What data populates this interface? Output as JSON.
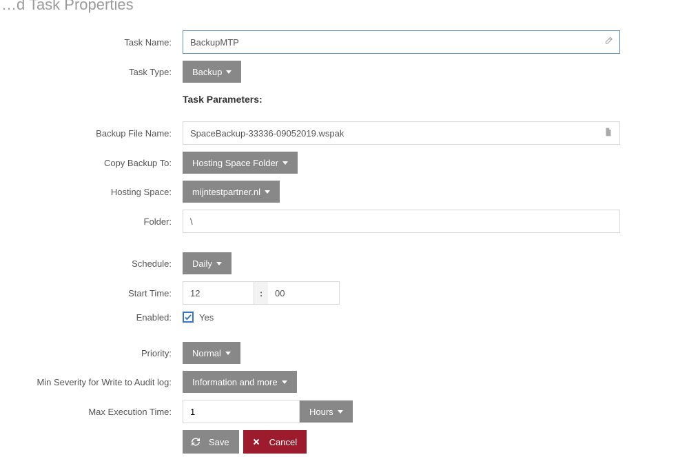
{
  "page_title": "…d Task Properties",
  "labels": {
    "task_name": "Task Name:",
    "task_type": "Task Type:",
    "task_parameters": "Task Parameters:",
    "backup_file_name": "Backup File Name:",
    "copy_backup_to": "Copy Backup To:",
    "hosting_space": "Hosting Space:",
    "folder": "Folder:",
    "schedule": "Schedule:",
    "start_time": "Start Time:",
    "enabled": "Enabled:",
    "enabled_yes": "Yes",
    "priority": "Priority:",
    "min_severity": "Min Severity for Write to Audit log:",
    "max_execution": "Max Execution Time:"
  },
  "values": {
    "task_name": "BackupMTP",
    "task_type": "Backup",
    "backup_file_name": "SpaceBackup-33336-09052019.wspak",
    "copy_backup_to": "Hosting Space Folder",
    "hosting_space": "mijntestpartner.nl",
    "folder": "\\",
    "schedule": "Daily",
    "start_time_h": "12",
    "start_time_m": "00",
    "enabled": true,
    "priority": "Normal",
    "min_severity": "Information and more",
    "max_execution_num": "1",
    "max_execution_unit": "Hours"
  },
  "buttons": {
    "save": "Save",
    "cancel": "Cancel"
  },
  "time_sep": ":"
}
